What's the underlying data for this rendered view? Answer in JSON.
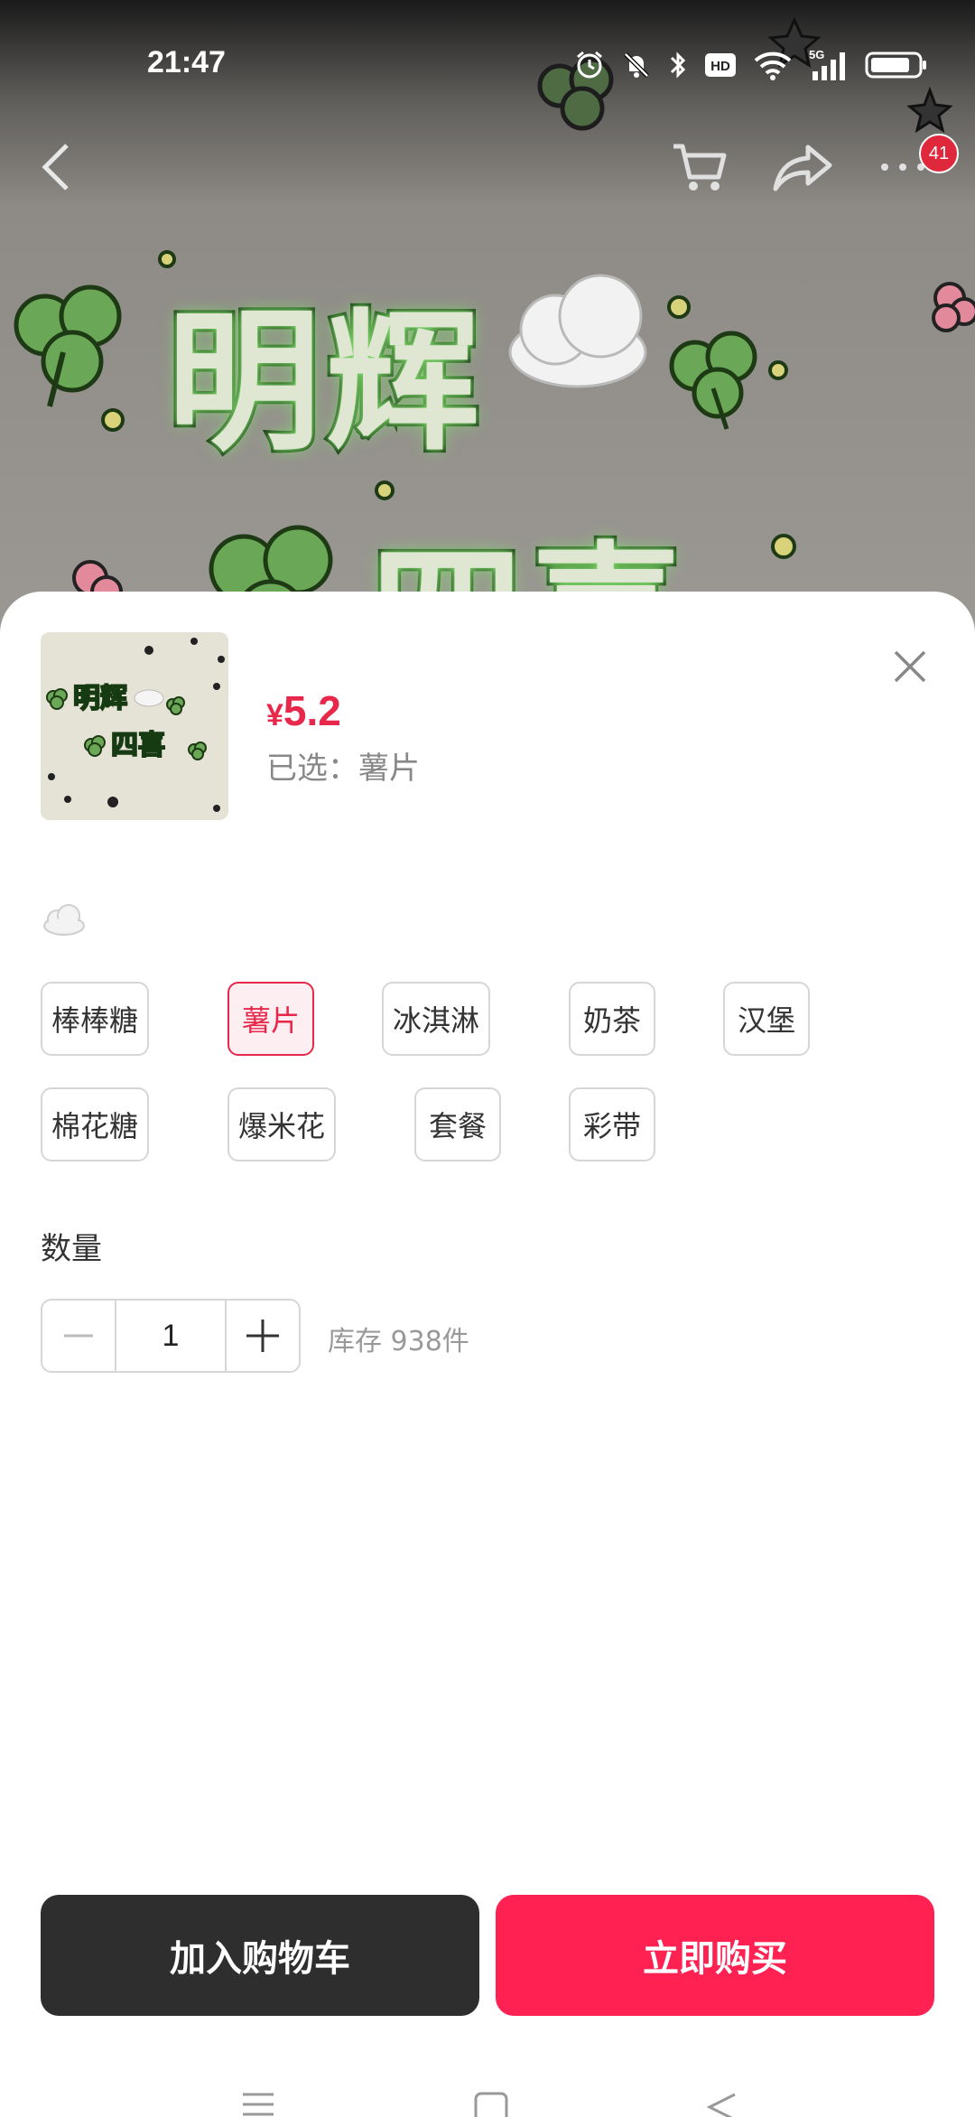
{
  "status_bar": {
    "time": "21:47",
    "network": "5G",
    "hd": "HD"
  },
  "nav": {
    "cart_badge": "41"
  },
  "banner": {
    "line1": "明辉",
    "line2": "四喜"
  },
  "product": {
    "thumb_line1": "明辉",
    "thumb_line2": "四喜",
    "currency": "¥",
    "price": "5.2",
    "selected_text": "已选：薯片"
  },
  "spec": {
    "icon": "cloud-icon",
    "options": [
      {
        "label": "棒棒糖",
        "active": false
      },
      {
        "label": "薯片",
        "active": true
      },
      {
        "label": "冰淇淋",
        "active": false
      },
      {
        "label": "奶茶",
        "active": false
      },
      {
        "label": "汉堡",
        "active": false
      },
      {
        "label": "棉花糖",
        "active": false
      },
      {
        "label": "爆米花",
        "active": false
      },
      {
        "label": "套餐",
        "active": false
      },
      {
        "label": "彩带",
        "active": false
      }
    ]
  },
  "quantity": {
    "label": "数量",
    "value": "1",
    "stock": "库存 938件"
  },
  "actions": {
    "add_to_cart": "加入购物车",
    "buy_now": "立即购买"
  },
  "colors": {
    "accent": "#e8284a",
    "buy_button": "#fe2151",
    "cart_button": "#2e2e2e"
  }
}
